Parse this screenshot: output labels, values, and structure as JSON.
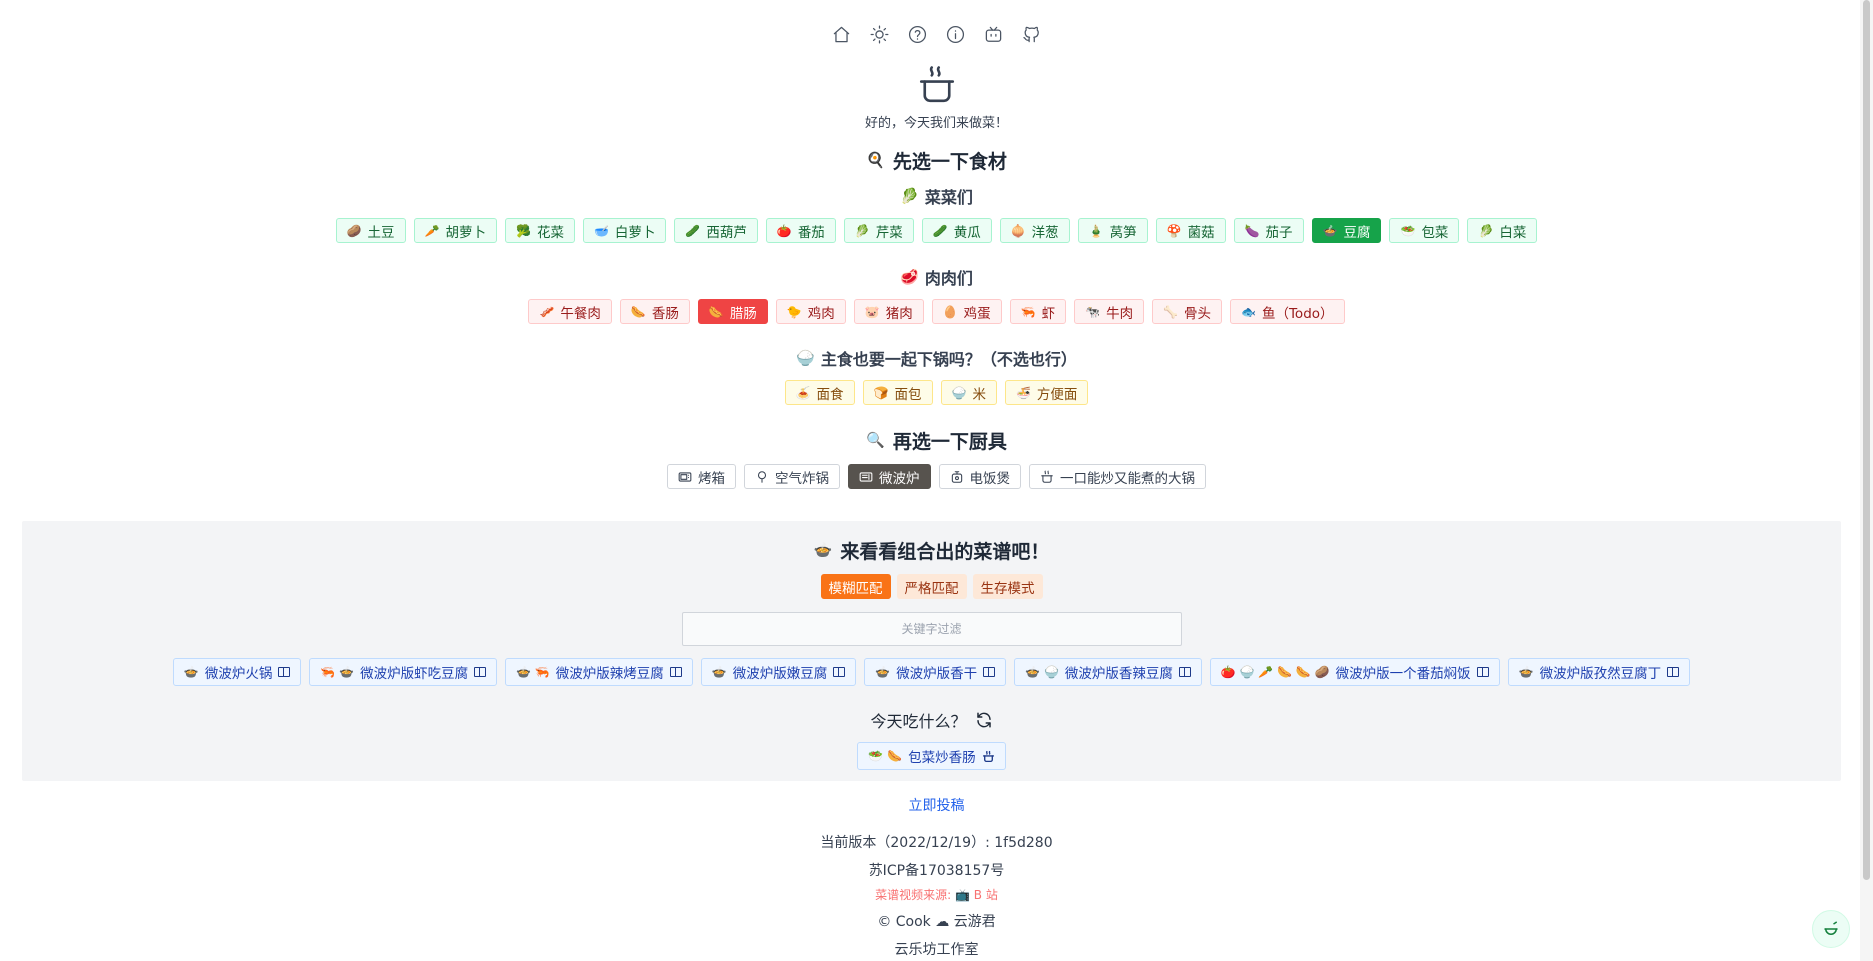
{
  "nav": {
    "items": [
      "home-icon",
      "sun-icon",
      "help-circle-icon",
      "info-icon",
      "bilibili-tv-icon",
      "github-icon"
    ]
  },
  "subtitle": "好的，今天我们来做菜！",
  "ingredients_title": "先选一下食材",
  "vegetables": {
    "title": "菜菜们",
    "emoji": "🥬",
    "items": [
      {
        "emoji": "🥔",
        "label": "土豆"
      },
      {
        "emoji": "🥕",
        "label": "胡萝卜"
      },
      {
        "emoji": "🥦",
        "label": "花菜"
      },
      {
        "emoji": "🥣",
        "label": "白萝卜"
      },
      {
        "emoji": "🥒",
        "label": "西葫芦"
      },
      {
        "emoji": "🍅",
        "label": "番茄"
      },
      {
        "emoji": "🥬",
        "label": "芹菜"
      },
      {
        "emoji": "🥒",
        "label": "黄瓜"
      },
      {
        "emoji": "🧅",
        "label": "洋葱"
      },
      {
        "emoji": "🎍",
        "label": "莴笋"
      },
      {
        "emoji": "🍄",
        "label": "菌菇"
      },
      {
        "emoji": "🍆",
        "label": "茄子"
      },
      {
        "emoji": "🍲",
        "label": "豆腐",
        "active": true
      },
      {
        "emoji": "🥗",
        "label": "包菜"
      },
      {
        "emoji": "🥬",
        "label": "白菜"
      }
    ]
  },
  "meats": {
    "title": "肉肉们",
    "emoji": "🥩",
    "items": [
      {
        "emoji": "🥓",
        "label": "午餐肉"
      },
      {
        "emoji": "🌭",
        "label": "香肠"
      },
      {
        "emoji": "🌭",
        "label": "腊肠",
        "active": true
      },
      {
        "emoji": "🐤",
        "label": "鸡肉"
      },
      {
        "emoji": "🐷",
        "label": "猪肉"
      },
      {
        "emoji": "🥚",
        "label": "鸡蛋"
      },
      {
        "emoji": "🦐",
        "label": "虾"
      },
      {
        "emoji": "🐄",
        "label": "牛肉"
      },
      {
        "emoji": "🦴",
        "label": "骨头"
      },
      {
        "emoji": "🐟",
        "label": "鱼（Todo）"
      }
    ]
  },
  "staples": {
    "title": "主食也要一起下锅吗？（不选也行）",
    "emoji": "🍚",
    "items": [
      {
        "emoji": "🍝",
        "label": "面食"
      },
      {
        "emoji": "🍞",
        "label": "面包"
      },
      {
        "emoji": "🍚",
        "label": "米"
      },
      {
        "emoji": "🍜",
        "label": "方便面"
      }
    ]
  },
  "tools_title": "再选一下厨具",
  "tools": [
    {
      "icon": "oven-icon",
      "label": "烤箱"
    },
    {
      "icon": "air-fryer-icon",
      "label": "空气炸锅"
    },
    {
      "icon": "microwave-icon",
      "label": "微波炉",
      "active": true
    },
    {
      "icon": "rice-cooker-icon",
      "label": "电饭煲"
    },
    {
      "icon": "pot-icon",
      "label": "一口能炒又能煮的大锅"
    }
  ],
  "results": {
    "title": "来看看组合出的菜谱吧！",
    "title_emoji": "🍲",
    "modes": [
      {
        "label": "模糊匹配",
        "active": true
      },
      {
        "label": "严格匹配"
      },
      {
        "label": "生存模式"
      }
    ],
    "filter_placeholder": "关键字过滤",
    "recipes": [
      {
        "emojis": "🍲",
        "label": "微波炉火锅"
      },
      {
        "emojis": "🦐 🍲",
        "label": "微波炉版虾吃豆腐"
      },
      {
        "emojis": "🍲 🦐",
        "label": "微波炉版辣烤豆腐"
      },
      {
        "emojis": "🍲",
        "label": "微波炉版嫩豆腐"
      },
      {
        "emojis": "🍲",
        "label": "微波炉版香干"
      },
      {
        "emojis": "🍲 🍚",
        "label": "微波炉版香辣豆腐"
      },
      {
        "emojis": "🍅 🍚 🥕 🌭 🌭 🥔",
        "label": "微波炉版一个番茄焖饭"
      },
      {
        "emojis": "🍲",
        "label": "微波炉版孜然豆腐丁"
      }
    ],
    "random_title": "今天吃什么？",
    "random_recipe": {
      "emojis": "🥗 🌭",
      "label": "包菜炒香肠"
    }
  },
  "footer": {
    "submit_link": "立即投稿",
    "version": "当前版本（2022/12/19）: 1f5d280",
    "icp": "苏ICP备17038157号",
    "video_source_label": "菜谱视频来源:",
    "video_source_link": "B 站",
    "copyright": "© Cook",
    "author": "云游君",
    "studio": "云乐坊工作室"
  }
}
